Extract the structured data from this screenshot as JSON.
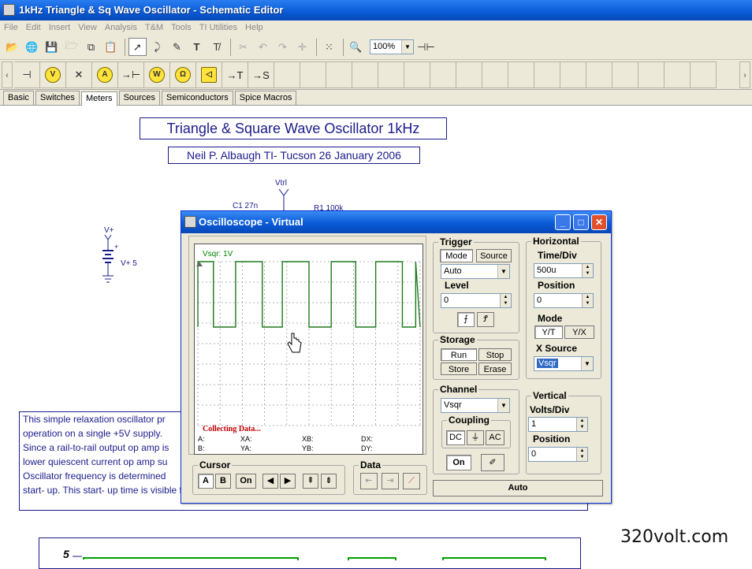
{
  "window": {
    "title": "1kHz Triangle & Sq Wave Oscillator - Schematic Editor"
  },
  "menu": [
    "File",
    "Edit",
    "Insert",
    "View",
    "Analysis",
    "T&M",
    "Tools",
    "TI Utilities",
    "Help"
  ],
  "toolbar": {
    "zoom": "100%"
  },
  "tabs": [
    "Basic",
    "Switches",
    "Meters",
    "Sources",
    "Semiconductors",
    "Spice Macros"
  ],
  "schematic": {
    "title": "Triangle & Square Wave Oscillator 1kHz",
    "author": "Neil P. Albaugh  TI- Tucson  26 January 2006",
    "labels": {
      "vtrl": "Vtrl",
      "c1": "C1 27n",
      "r1": "R1 100k",
      "vplus": "V+",
      "vplus5": "V+ 5"
    },
    "description": [
      "This simple relaxation oscillator pr",
      "operation on a single +5V supply.",
      "Since a rail-to-rail output op amp is",
      "lower quiescent current op amp su",
      "",
      "Oscillator frequency is determined",
      "start- up. This start- up time is visible for the first few milliseconds in the waveform below."
    ],
    "graph_y_label": "5"
  },
  "watermark": "320volt.com",
  "scope": {
    "title": "Oscilloscope - Virtual",
    "screen": {
      "channel_label": "Vsqr: 1V",
      "status": "Collecting Data...",
      "readouts": {
        "a": "A:",
        "b": "B:",
        "xa": "XA:",
        "ya": "YA:",
        "xb": "XB:",
        "yb": "YB:",
        "dx": "DX:",
        "dy": "DY:"
      }
    },
    "cursor": {
      "title": "Cursor",
      "a": "A",
      "b": "B",
      "on": "On"
    },
    "data_group": {
      "title": "Data"
    },
    "trigger": {
      "title": "Trigger",
      "mode": "Mode",
      "source": "Source",
      "mode_value": "Auto",
      "level_label": "Level",
      "level_value": "0"
    },
    "storage": {
      "title": "Storage",
      "run": "Run",
      "stop": "Stop",
      "store": "Store",
      "erase": "Erase"
    },
    "horizontal": {
      "title": "Horizontal",
      "time_div_label": "Time/Div",
      "time_div": "500u",
      "position_label": "Position",
      "position": "0",
      "mode_label": "Mode",
      "yt": "Y/T",
      "yx": "Y/X",
      "xsource_label": "X Source",
      "xsource": "Vsqr"
    },
    "channel": {
      "title": "Channel",
      "value": "Vsqr",
      "coupling_title": "Coupling",
      "dc": "DC",
      "ac": "AC",
      "on": "On"
    },
    "vertical": {
      "title": "Vertical",
      "volts_div_label": "Volts/Div",
      "volts_div": "1",
      "position_label": "Position",
      "position": "0"
    },
    "auto": "Auto"
  }
}
